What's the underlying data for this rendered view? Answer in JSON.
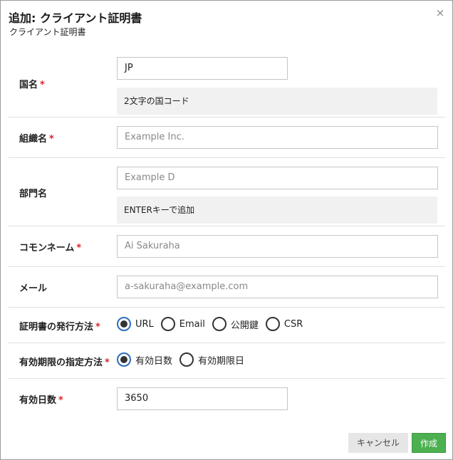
{
  "dialog": {
    "title": "追加: クライアント証明書",
    "subtitle": "クライアント証明書",
    "close_glyph": "×"
  },
  "required_mark": "*",
  "fields": {
    "country": {
      "label": "国名",
      "value": "JP",
      "hint": "2文字の国コード"
    },
    "organization": {
      "label": "組織名",
      "placeholder": "Example Inc."
    },
    "department": {
      "label": "部門名",
      "placeholder": "Example D",
      "hint": "ENTERキーで追加"
    },
    "common_name": {
      "label": "コモンネーム",
      "placeholder": "Ai Sakuraha"
    },
    "email": {
      "label": "メール",
      "placeholder": "a-sakuraha@example.com"
    },
    "issue_method": {
      "label": "証明書の発行方法",
      "options": [
        "URL",
        "Email",
        "公開鍵",
        "CSR"
      ],
      "selected": "URL"
    },
    "expiry_method": {
      "label": "有効期限の指定方法",
      "options": [
        "有効日数",
        "有効期限日"
      ],
      "selected": "有効日数"
    },
    "valid_days": {
      "label": "有効日数",
      "value": "3650"
    }
  },
  "buttons": {
    "cancel": "キャンセル",
    "create": "作成"
  },
  "colors": {
    "required": "#d9252a",
    "create_button": "#4caf50",
    "radio_selected_ring": "#2d6ebf"
  }
}
